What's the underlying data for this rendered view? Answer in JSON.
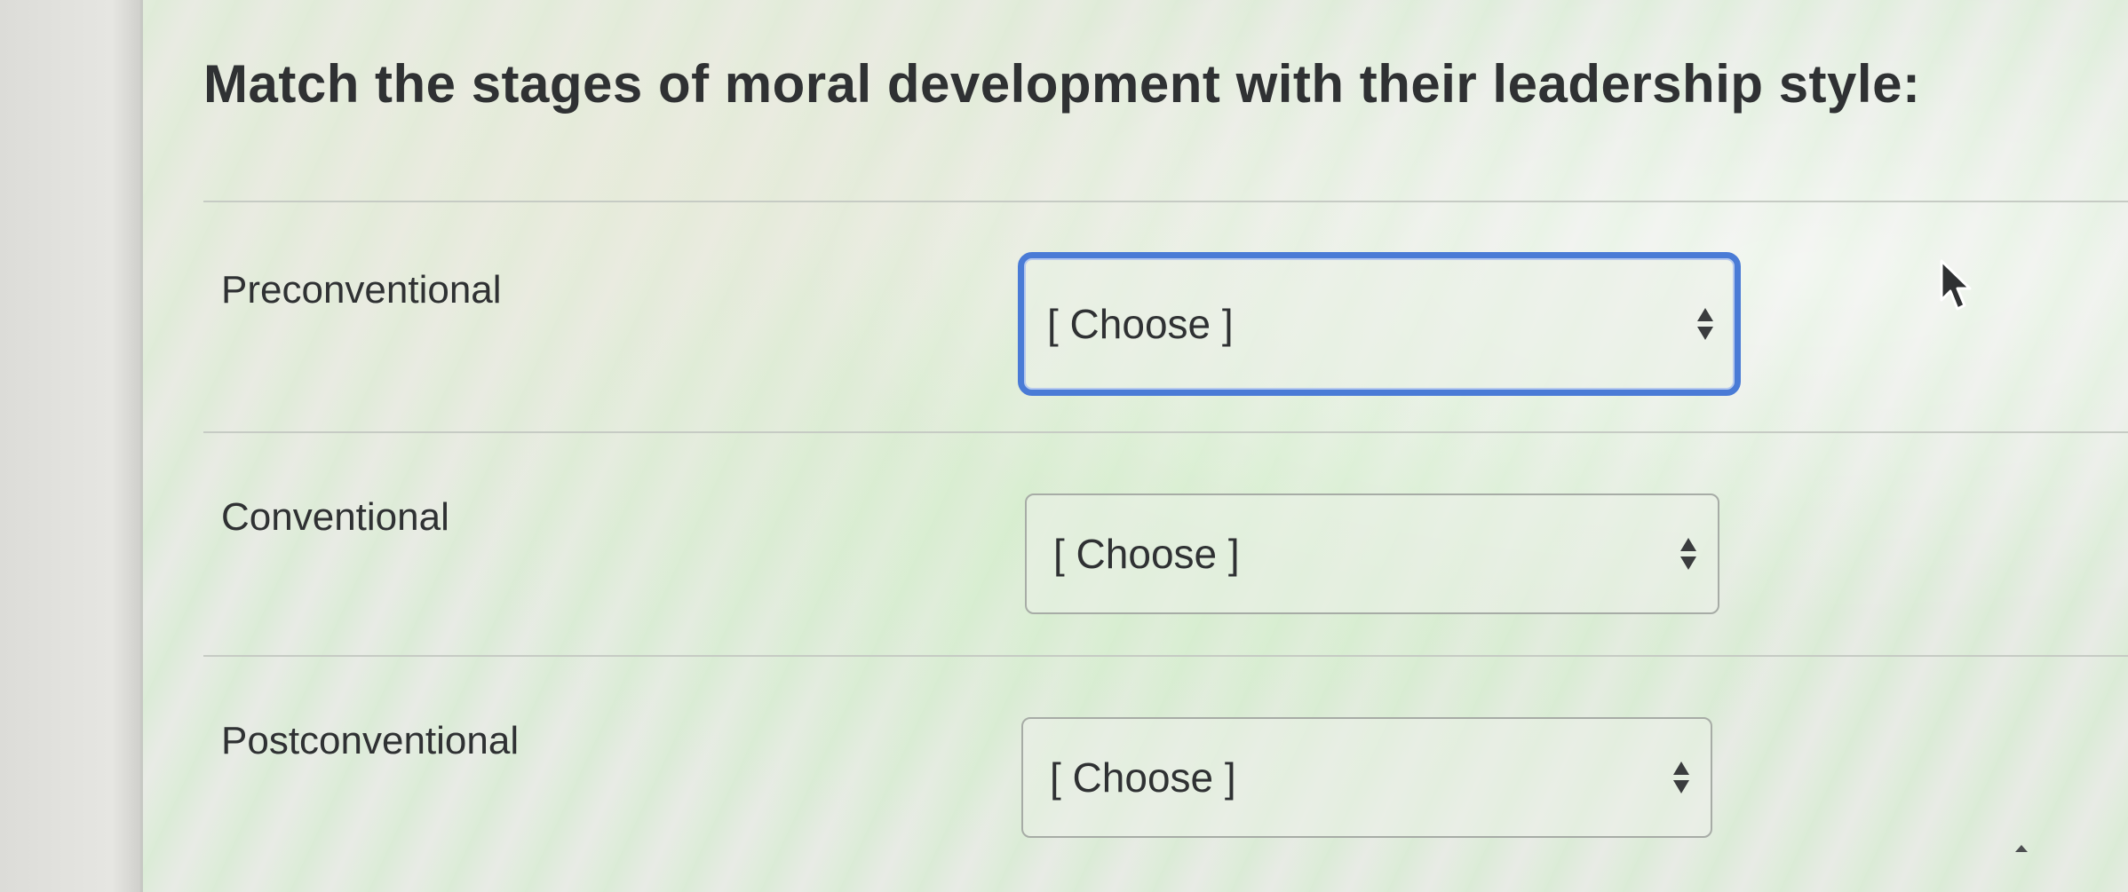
{
  "question": {
    "title": "Match the stages of moral development with their leadership style:"
  },
  "rows": [
    {
      "label": "Preconventional",
      "select_value": "[ Choose ]",
      "focused": true
    },
    {
      "label": "Conventional",
      "select_value": "[ Choose ]",
      "focused": false
    },
    {
      "label": "Postconventional",
      "select_value": "[ Choose ]",
      "focused": false
    }
  ],
  "colors": {
    "focus_ring": "#4a7bd6",
    "text": "#2f3133",
    "divider": "#c6cbc4"
  },
  "icons": {
    "select_arrows": "up-down-arrows-icon",
    "pointer": "mouse-cursor-icon"
  }
}
